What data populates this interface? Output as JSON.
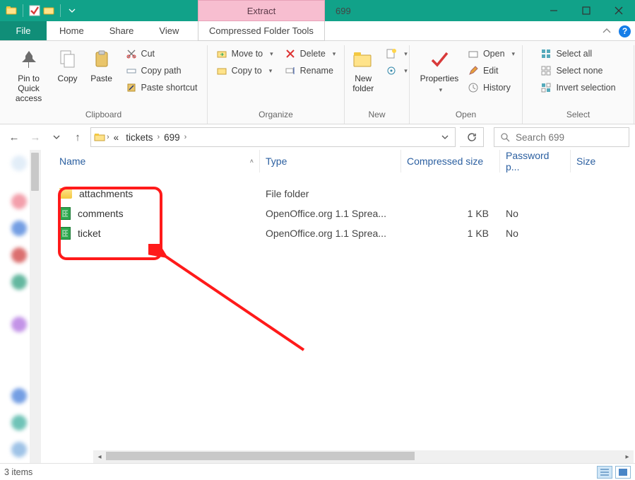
{
  "titlebar": {
    "context_tab_label": "Extract",
    "window_title": "699",
    "qat": {
      "folder_icon": "folder-icon",
      "check_icon": "check-icon",
      "pin_icon": "pin-folder-icon"
    }
  },
  "tabs": {
    "file": "File",
    "home": "Home",
    "share": "Share",
    "view": "View",
    "context": "Compressed Folder Tools"
  },
  "ribbon": {
    "clipboard": {
      "label": "Clipboard",
      "pin": "Pin to Quick access",
      "copy": "Copy",
      "paste": "Paste",
      "cut": "Cut",
      "copy_path": "Copy path",
      "paste_shortcut": "Paste shortcut"
    },
    "organize": {
      "label": "Organize",
      "move_to": "Move to",
      "copy_to": "Copy to",
      "delete": "Delete",
      "rename": "Rename"
    },
    "new": {
      "label": "New",
      "new_folder": "New folder"
    },
    "open": {
      "label": "Open",
      "properties": "Properties",
      "open": "Open",
      "edit": "Edit",
      "history": "History"
    },
    "select": {
      "label": "Select",
      "select_all": "Select all",
      "select_none": "Select none",
      "invert": "Invert selection"
    }
  },
  "address": {
    "crumbs": [
      "tickets",
      "699"
    ],
    "search_placeholder": "Search 699"
  },
  "columns": {
    "name": "Name",
    "type": "Type",
    "csize": "Compressed size",
    "pw": "Password p...",
    "size": "Size"
  },
  "files": [
    {
      "icon": "folder",
      "name": "attachments",
      "type": "File folder",
      "csize": "",
      "pw": ""
    },
    {
      "icon": "ods",
      "name": "comments",
      "type": "OpenOffice.org 1.1 Sprea...",
      "csize": "1 KB",
      "pw": "No"
    },
    {
      "icon": "ods",
      "name": "ticket",
      "type": "OpenOffice.org 1.1 Sprea...",
      "csize": "1 KB",
      "pw": "No"
    }
  ],
  "statusbar": {
    "text": "3 items"
  }
}
